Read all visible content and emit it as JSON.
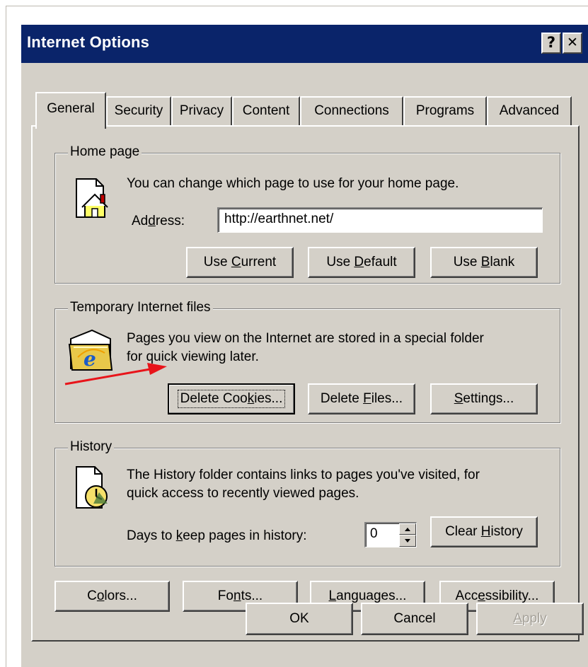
{
  "window": {
    "title": "Internet Options",
    "help_button": "?",
    "close_button": "✕"
  },
  "tabs": [
    {
      "label": "General",
      "active": true
    },
    {
      "label": "Security"
    },
    {
      "label": "Privacy"
    },
    {
      "label": "Content"
    },
    {
      "label": "Connections"
    },
    {
      "label": "Programs"
    },
    {
      "label": "Advanced"
    }
  ],
  "home_page": {
    "group_label": "Home page",
    "description": "You can change which page to use for your home page.",
    "address_label_pre": "Ad",
    "address_label_key": "d",
    "address_label_post": "ress:",
    "address_value": "http://earthnet.net/",
    "buttons": {
      "use_current": {
        "pre": "Use ",
        "key": "C",
        "post": "urrent"
      },
      "use_default": {
        "pre": "Use ",
        "key": "D",
        "post": "efault"
      },
      "use_blank": {
        "pre": "Use ",
        "key": "B",
        "post": "lank"
      }
    }
  },
  "temp_files": {
    "group_label": "Temporary Internet files",
    "description_line1": "Pages you view on the Internet are stored in a special folder",
    "description_line2": "for quick viewing later.",
    "buttons": {
      "delete_cookies": {
        "pre": "Delete Coo",
        "key": "k",
        "post": "ies..."
      },
      "delete_files": {
        "pre": "Delete ",
        "key": "F",
        "post": "iles..."
      },
      "settings": {
        "pre": "",
        "key": "S",
        "post": "ettings..."
      }
    }
  },
  "history": {
    "group_label": "History",
    "description_line1": "The History folder contains links to pages you've visited, for",
    "description_line2": "quick access to recently viewed pages.",
    "days_label_pre": "Days to ",
    "days_label_key": "k",
    "days_label_post": "eep pages in history:",
    "days_value": "0",
    "clear_button": {
      "pre": "Clear ",
      "key": "H",
      "post": "istory"
    }
  },
  "bottom_buttons": {
    "colors": {
      "pre": "C",
      "key": "o",
      "post": "lors..."
    },
    "fonts": {
      "pre": "Fo",
      "key": "n",
      "post": "ts..."
    },
    "languages": {
      "pre": "",
      "key": "L",
      "post": "anguages..."
    },
    "accessibility": {
      "pre": "Acc",
      "key": "e",
      "post": "ssibility..."
    }
  },
  "dialog_buttons": {
    "ok": "OK",
    "cancel": "Cancel",
    "apply": {
      "pre": "",
      "key": "A",
      "post": "pply"
    }
  },
  "annotation": {
    "arrow_color": "#e8141a"
  },
  "colors": {
    "titlebar": "#0a246a",
    "face": "#d4d0c8"
  }
}
